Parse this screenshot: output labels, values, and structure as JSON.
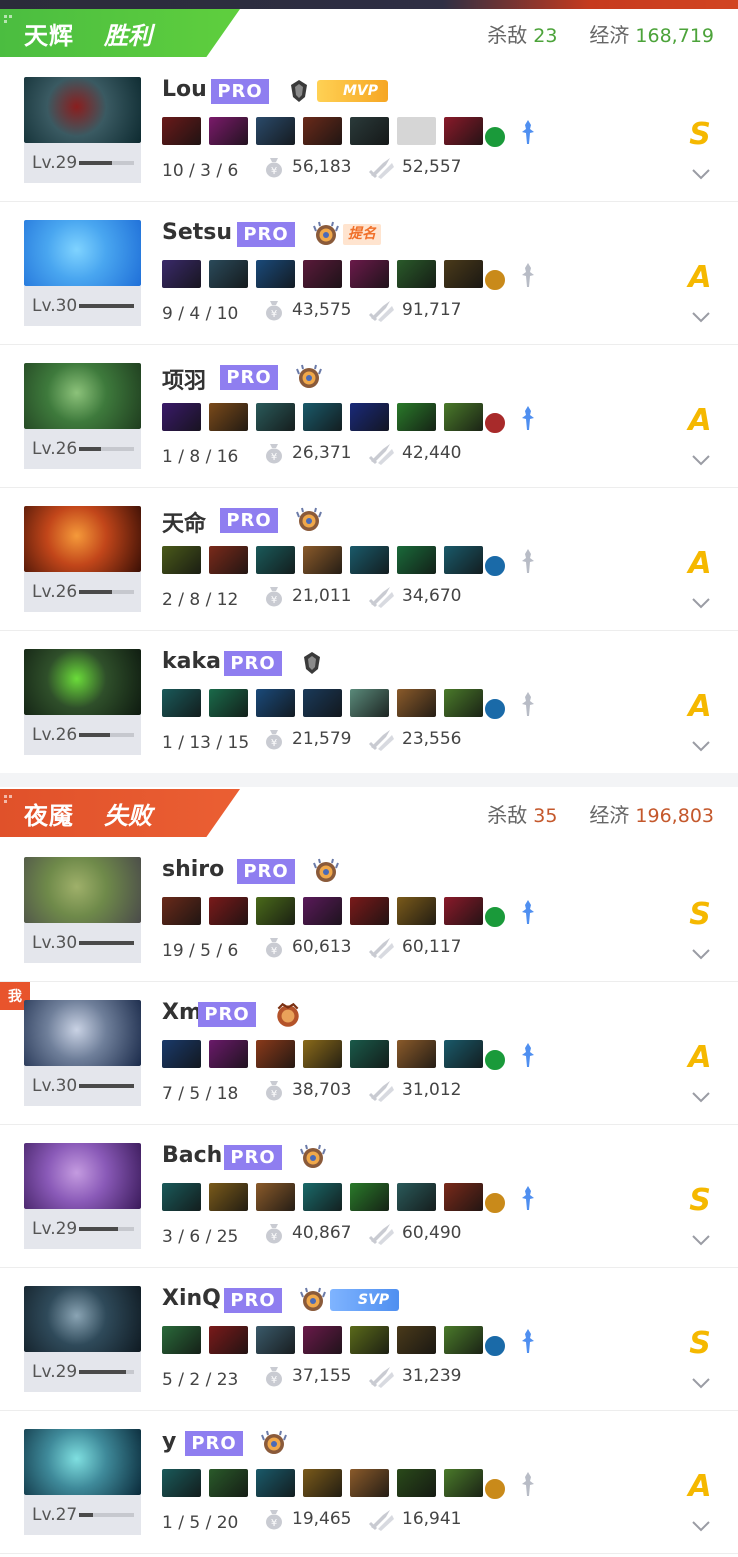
{
  "colors": {
    "radiant": "#4bbd40",
    "dire": "#e0512a",
    "pro_badge": "#8f7ef0",
    "grade": "#f5b800"
  },
  "icons": {
    "gold": "money-bag-icon",
    "damage": "sword-damage-icon",
    "expand": "chevron-down-icon",
    "aghanim": "aghanim-scepter-icon"
  },
  "teams": [
    {
      "name": "天辉",
      "result": "胜利",
      "kills_label": "杀敌",
      "kills": "23",
      "economy_label": "经济",
      "economy": "168,719",
      "players": [
        {
          "name": "Lou",
          "badge": "PRO",
          "tag": "MVP",
          "level": "Lv.29",
          "level_progress": 0.6,
          "kda": "10 / 3 / 6",
          "gold": "56,183",
          "damage": "52,557",
          "grade": "S"
        },
        {
          "name": "Setsu",
          "badge": "PRO",
          "tag": "提名",
          "level": "Lv.30",
          "level_progress": 1.0,
          "kda": "9 / 4 / 10",
          "gold": "43,575",
          "damage": "91,717",
          "grade": "A"
        },
        {
          "name": "项羽",
          "badge": "PRO",
          "tag": "",
          "level": "Lv.26",
          "level_progress": 0.4,
          "kda": "1 / 8 / 16",
          "gold": "26,371",
          "damage": "42,440",
          "grade": "A"
        },
        {
          "name": "天命",
          "badge": "PRO",
          "tag": "",
          "level": "Lv.26",
          "level_progress": 0.6,
          "kda": "2 / 8 / 12",
          "gold": "21,011",
          "damage": "34,670",
          "grade": "A"
        },
        {
          "name": "kaka",
          "badge": "PRO",
          "tag": "",
          "level": "Lv.26",
          "level_progress": 0.55,
          "kda": "1 / 13 / 15",
          "gold": "21,579",
          "damage": "23,556",
          "grade": "A"
        }
      ]
    },
    {
      "name": "夜魇",
      "result": "失败",
      "kills_label": "杀敌",
      "kills": "35",
      "economy_label": "经济",
      "economy": "196,803",
      "players": [
        {
          "name": "shiro",
          "badge": "PRO",
          "tag": "",
          "level": "Lv.30",
          "level_progress": 1.0,
          "kda": "19 / 5 / 6",
          "gold": "60,613",
          "damage": "60,117",
          "grade": "S"
        },
        {
          "name": "Xm",
          "badge": "PRO",
          "tag": "",
          "me": "我",
          "level": "Lv.30",
          "level_progress": 1.0,
          "kda": "7 / 5 / 18",
          "gold": "38,703",
          "damage": "31,012",
          "grade": "A"
        },
        {
          "name": "Bach",
          "badge": "PRO",
          "tag": "",
          "level": "Lv.29",
          "level_progress": 0.7,
          "kda": "3 / 6 / 25",
          "gold": "40,867",
          "damage": "60,490",
          "grade": "S"
        },
        {
          "name": "XinQ",
          "badge": "PRO",
          "tag": "SVP",
          "level": "Lv.29",
          "level_progress": 0.85,
          "kda": "5 / 2 / 23",
          "gold": "37,155",
          "damage": "31,239",
          "grade": "S"
        },
        {
          "name": "y",
          "badge": "PRO",
          "tag": "",
          "level": "Lv.27",
          "level_progress": 0.25,
          "kda": "1 / 5 / 20",
          "gold": "19,465",
          "damage": "16,941",
          "grade": "A"
        }
      ]
    }
  ]
}
